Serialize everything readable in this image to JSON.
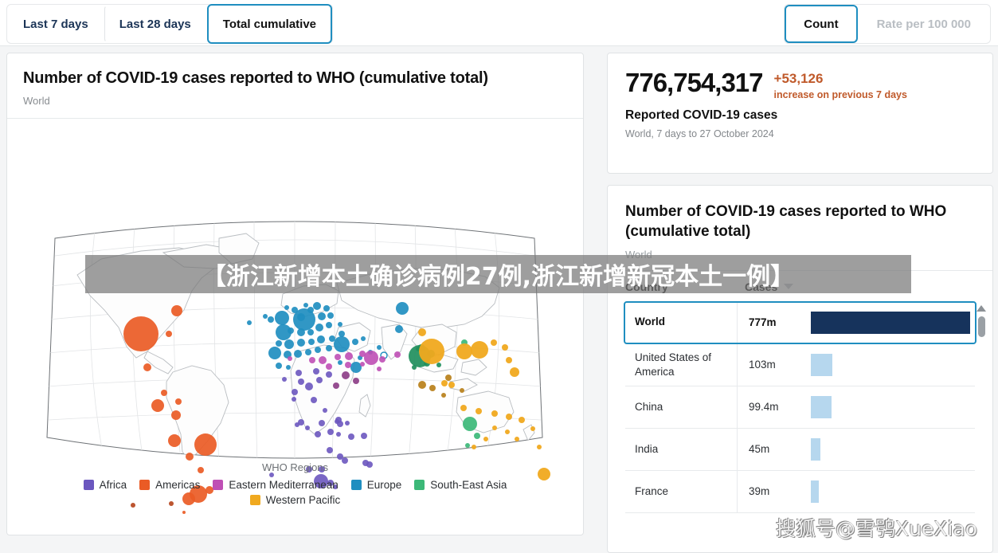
{
  "toolbar": {
    "tabs": [
      {
        "label": "Last 7 days",
        "active": false
      },
      {
        "label": "Last 28 days",
        "active": false
      },
      {
        "label": "Total cumulative",
        "active": true
      }
    ],
    "measure_toggle": [
      {
        "label": "Count",
        "active": true
      },
      {
        "label": "Rate per 100 000",
        "active": false
      }
    ]
  },
  "map_card": {
    "title": "Number of COVID-19 cases reported to WHO (cumulative total)",
    "subtitle": "World",
    "legend_title": "WHO Regions",
    "legend": [
      {
        "label": "Africa",
        "color": "#6b57bf"
      },
      {
        "label": "Americas",
        "color": "#ea5b25"
      },
      {
        "label": "Eastern Mediterranean",
        "color": "#c council"
      },
      {
        "label": "Europe",
        "color": "#1f8ec0"
      },
      {
        "label": "South-East Asia",
        "color": "#3cb878"
      },
      {
        "label": "Western Pacific",
        "color": "#f0a91f"
      }
    ]
  },
  "stat_card": {
    "value": "776,754,317",
    "delta_value": "+53,126",
    "delta_label": "increase on previous 7 days",
    "metric_label": "Reported COVID-19 cases",
    "scope_label": "World, 7 days to 27 October 2024",
    "delta_color": "#c05a2b"
  },
  "table_card": {
    "title": "Number of COVID-19 cases reported to WHO (cumulative total)",
    "subtitle": "World",
    "columns": [
      "Country",
      "Cases"
    ],
    "sort": {
      "column": "Cases",
      "direction": "desc"
    },
    "rows": [
      {
        "country": "World",
        "cases": "777m",
        "bar_pct": 100,
        "selected": true
      },
      {
        "country": "United States of America",
        "cases": "103m",
        "bar_pct": 13.3,
        "selected": false
      },
      {
        "country": "China",
        "cases": "99.4m",
        "bar_pct": 12.8,
        "selected": false
      },
      {
        "country": "India",
        "cases": "45m",
        "bar_pct": 5.8,
        "selected": false
      },
      {
        "country": "France",
        "cases": "39m",
        "bar_pct": 5.0,
        "selected": false
      }
    ],
    "bar_color": "#b6d7ee",
    "bar_color_selected": "#16335c"
  },
  "watermarks": {
    "banner": "【浙江新增本土确诊病例27例,浙江新增新冠本土一例】",
    "corner": "搜狐号@雪鸮XueXiao"
  },
  "chart_data": {
    "type": "scatter",
    "title": "Number of COVID-19 cases reported to WHO (cumulative total)",
    "subtitle": "World",
    "description": "Proportional-symbol world map; bubble area encodes cumulative reported COVID-19 cases per country, colored by WHO region.",
    "legend_title": "WHO Regions",
    "legend_position": "bottom",
    "grid": true,
    "series": [
      {
        "name": "Africa",
        "color": "#6b57bf"
      },
      {
        "name": "Americas",
        "color": "#ea5b25"
      },
      {
        "name": "Eastern Mediterranean",
        "color": "#c council"
      },
      {
        "name": "Europe",
        "color": "#1f8ec0"
      },
      {
        "name": "South-East Asia",
        "color": "#3cb878"
      },
      {
        "name": "Western Pacific",
        "color": "#f0a91f"
      }
    ],
    "top_values": [
      {
        "label": "World",
        "value": 777000000,
        "display": "777m"
      },
      {
        "label": "United States of America",
        "value": 103000000,
        "display": "103m"
      },
      {
        "label": "China",
        "value": 99400000,
        "display": "99.4m"
      },
      {
        "label": "India",
        "value": 45000000,
        "display": "45m"
      },
      {
        "label": "France",
        "value": 39000000,
        "display": "39m"
      }
    ]
  }
}
